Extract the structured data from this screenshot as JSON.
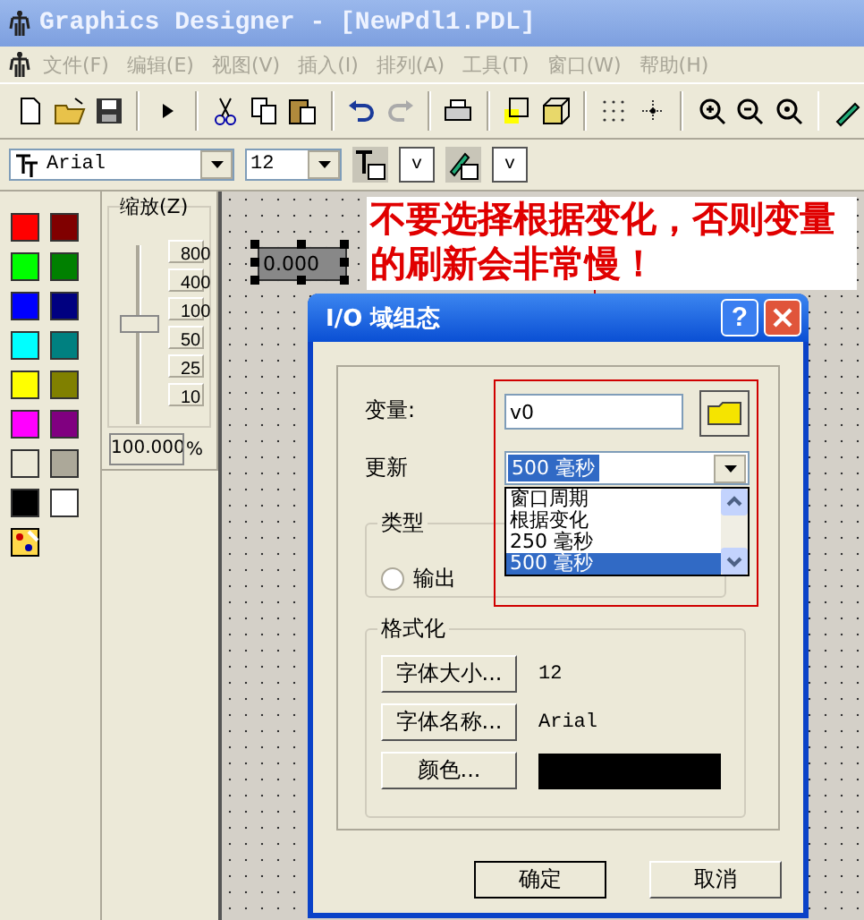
{
  "window": {
    "title": "Graphics Designer - [NewPdl1.PDL]"
  },
  "menu": [
    "文件(F)",
    "编辑(E)",
    "视图(V)",
    "插入(I)",
    "排列(A)",
    "工具(T)",
    "窗口(W)",
    "帮助(H)"
  ],
  "font_toolbar": {
    "font": "Arial",
    "size": "12",
    "buttons": [
      "v",
      "v"
    ]
  },
  "palette": [
    {
      "color": "#ff0000"
    },
    {
      "color": "#800000"
    },
    {
      "color": "#00ff00"
    },
    {
      "color": "#008000"
    },
    {
      "color": "#0000ff"
    },
    {
      "color": "#000080"
    },
    {
      "color": "#00ffff"
    },
    {
      "color": "#008080"
    },
    {
      "color": "#ffff00"
    },
    {
      "color": "#808000"
    },
    {
      "color": "#ff00ff"
    },
    {
      "color": "#800080"
    },
    {
      "color": "#ece9d8"
    },
    {
      "color": "#aca899"
    },
    {
      "color": "#000000"
    },
    {
      "color": "#ffffff"
    }
  ],
  "zoom": {
    "label": "缩放(Z)",
    "marks": [
      "800",
      "400",
      "100",
      "50",
      "25",
      "10"
    ],
    "level": 0.56,
    "value": "100.000",
    "unit": "%"
  },
  "canvas": {
    "io_field": "0.000",
    "annotation": "不要选择根据变化，否则变量的刷新会非常慢！"
  },
  "dialog": {
    "title": "I/O 域组态",
    "help": "?",
    "variable": {
      "label": "变量:",
      "value": "v0"
    },
    "update": {
      "label": "更新",
      "value": "500 毫秒",
      "options": [
        {
          "label": "窗口周期",
          "selected": false
        },
        {
          "label": "根据变化",
          "selected": false
        },
        {
          "label": "250 毫秒",
          "selected": false
        },
        {
          "label": "500 毫秒",
          "selected": true
        }
      ]
    },
    "type_group": {
      "label": "类型",
      "radio": {
        "label": "输出",
        "checked": false
      }
    },
    "format_group": {
      "label": "格式化",
      "rows": [
        {
          "kind": "text",
          "button": "字体大小...",
          "value": "12"
        },
        {
          "kind": "text",
          "button": "字体名称...",
          "value": "Arial"
        },
        {
          "kind": "color",
          "button": "颜色...",
          "color": "#000000"
        }
      ]
    },
    "buttons": [
      "确定",
      "取消"
    ]
  }
}
